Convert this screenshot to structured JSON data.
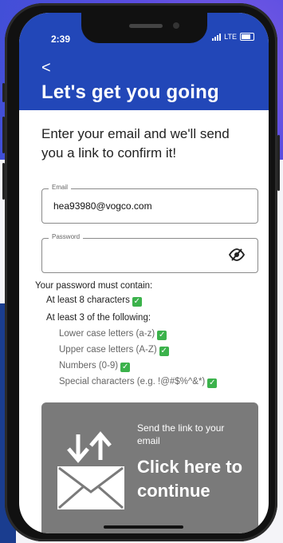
{
  "status_bar": {
    "time": "2:39",
    "network": "LTE"
  },
  "header": {
    "back_icon": "chevron-left-icon",
    "back_label": "<",
    "title": "Let's get you going"
  },
  "intro": "Enter your email and we'll send you a link to confirm it!",
  "email_field": {
    "label": "Email",
    "value": "hea93980@vogco.com"
  },
  "password_field": {
    "label": "Password",
    "value": "",
    "eye_icon": "eye-slash-icon"
  },
  "requirements": {
    "heading": "Your password must contain:",
    "min_length": "At least 8 characters",
    "min_categories": "At least 3 of the following:",
    "items": [
      "Lower case letters (a-z)",
      "Upper case letters (A-Z)",
      "Numbers (0-9)",
      "Special characters (e.g. !@#$%^&*)"
    ],
    "check_icon": "check-icon"
  },
  "cta": {
    "subtitle": "Send the link to your email",
    "title": "Click here to continue",
    "icon": "mail-send-icon"
  },
  "colors": {
    "header": "#2247b8",
    "check": "#3bb24b",
    "cta": "#7a7a7a"
  }
}
